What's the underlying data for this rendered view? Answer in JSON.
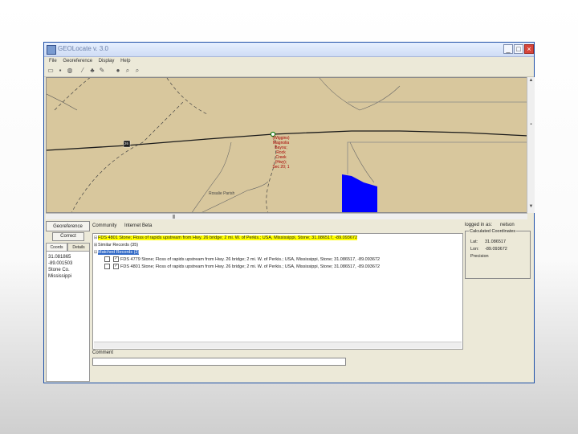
{
  "window": {
    "title": "GEOLocate v. 3.0",
    "minimize": "_",
    "maximize": "□",
    "close": "×"
  },
  "menubar": [
    "File",
    "Georeference",
    "Display",
    "Help"
  ],
  "map": {
    "highway_shield": "26",
    "red_label": "(Wiggins) Magnolia Bayou; Rock Creek (Hwy); Sec 20; 1",
    "road_tag": "Rosalie Parish"
  },
  "left": {
    "georeference_button": "Georeference",
    "correct_button": "Correct",
    "tabs": [
      "Coords",
      "Details"
    ],
    "coords_text": [
      "31.081865",
      "-89.001503",
      "Stone Co.",
      "Mississippi"
    ]
  },
  "center": {
    "community_label": "Community",
    "user_value": "Internet Beta",
    "tree": {
      "root_item": "FDS 4801 Stone; Floss of rapids upstream from Hwy. 26 bridge; 2 mi. W. of Perkis.; USA, Mississippi, Stone; 31.086517, -89.093672",
      "group1": "Similar Records (35)",
      "group2": "Matched Records (2)",
      "child1": "FDS 4779 Stone; Floss of rapids upstream from Hwy. 26 bridge; 2 mi. W. of Perkis.; USA, Mississippi, Stone; 31.086517, -89.093672",
      "child2": "FDS 4801 Stone; Floss of rapids upstream from Hwy. 26 bridge; 2 mi. W. of Perkis.; USA, Mississippi, Stone; 31.086517, -89.093672",
      "check": "✓"
    },
    "comment_label": "Comment"
  },
  "right": {
    "logged_label": "logged in as:",
    "logged_user": "nelson",
    "coords_legend": "Calculated Coordinates",
    "lat_label": "Lat:",
    "lat_value": "31.086517",
    "lon_label": "Lon:",
    "lon_value": "-89.093672",
    "precision_label": "Precision"
  },
  "colors": {
    "map_bg": "#d8c79d",
    "road": "#1a1a1a",
    "highlight": "#ffff00",
    "selection": "#3169c6",
    "shape": "#0000ff",
    "label_red": "#a60000"
  }
}
